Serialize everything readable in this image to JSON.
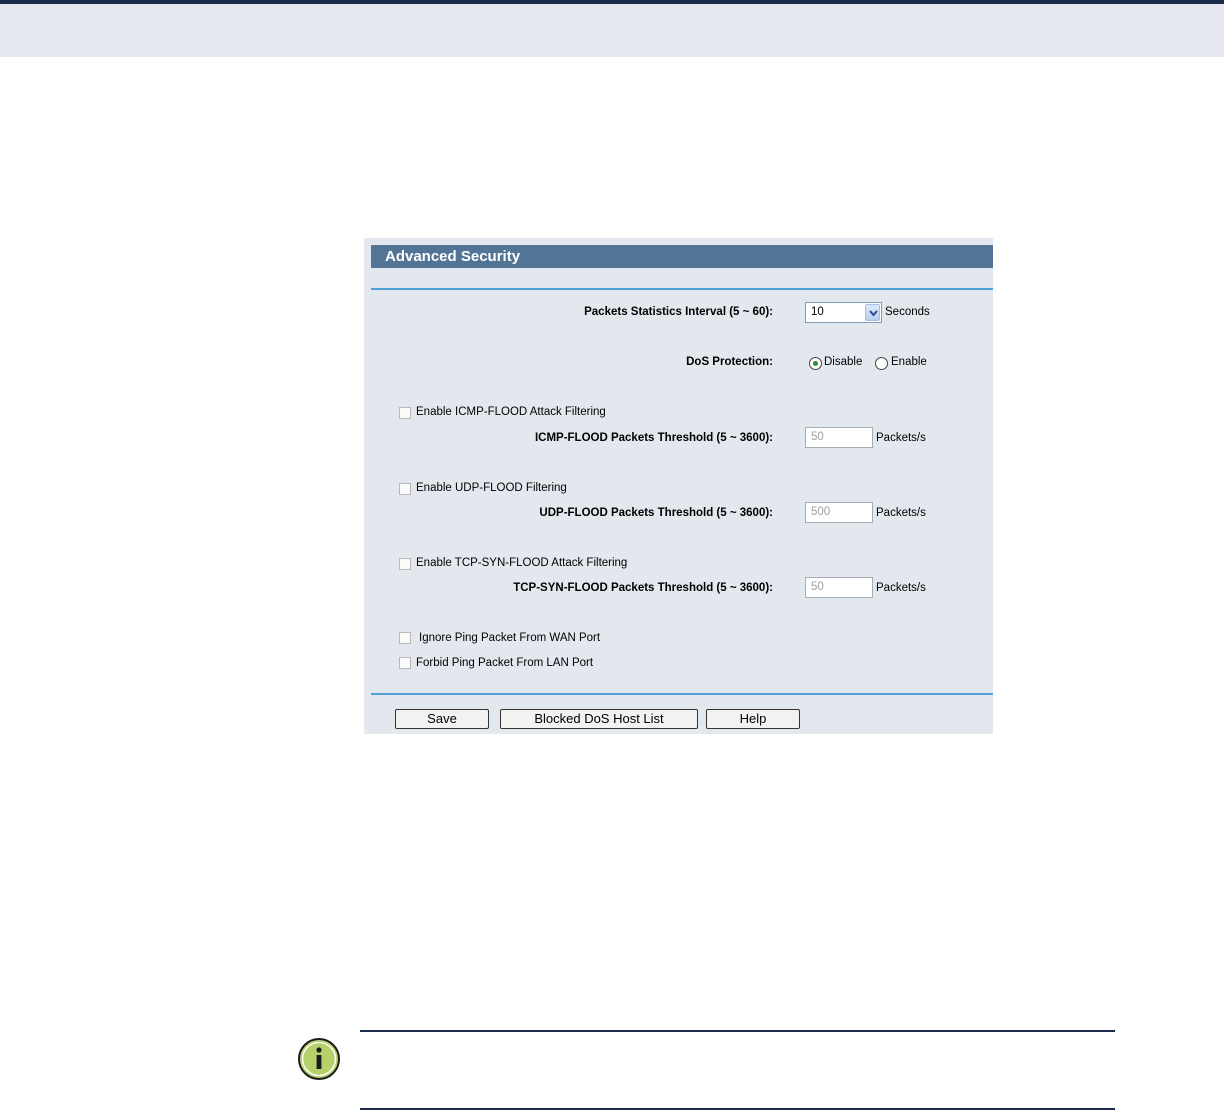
{
  "panel": {
    "title": "Advanced Security",
    "packets_interval": {
      "label": "Packets Statistics Interval (5 ~ 60):",
      "value": "10",
      "unit": "Seconds"
    },
    "dos_protection": {
      "label": "DoS Protection:",
      "options": [
        "Disable",
        "Enable"
      ],
      "selected": "Disable"
    },
    "icmp": {
      "checkbox_label": "Enable ICMP-FLOOD Attack Filtering",
      "checked": false,
      "threshold_label": "ICMP-FLOOD Packets Threshold (5 ~ 3600):",
      "value": "50",
      "unit": "Packets/s"
    },
    "udp": {
      "checkbox_label": "Enable UDP-FLOOD Filtering",
      "checked": false,
      "threshold_label": "UDP-FLOOD Packets Threshold (5 ~ 3600):",
      "value": "500",
      "unit": "Packets/s"
    },
    "tcp": {
      "checkbox_label": "Enable TCP-SYN-FLOOD Attack Filtering",
      "checked": false,
      "threshold_label": "TCP-SYN-FLOOD Packets Threshold (5 ~ 3600):",
      "value": "50",
      "unit": "Packets/s"
    },
    "ignore_ping_wan": {
      "label": "Ignore Ping Packet From WAN Port",
      "checked": false
    },
    "forbid_ping_lan": {
      "label": "Forbid Ping Packet From LAN Port",
      "checked": false
    },
    "buttons": {
      "save": "Save",
      "blocked_list": "Blocked DoS Host List",
      "help": "Help"
    }
  },
  "colors": {
    "panel_bg": "#e3e8ee",
    "title_bar": "#527595",
    "divider": "#4fa1d4",
    "radio_dot": "#2f8a3a",
    "note_icon": "#b5d16a"
  },
  "icons": {
    "note": "info-icon",
    "dropdown": "chevron-down-icon"
  }
}
